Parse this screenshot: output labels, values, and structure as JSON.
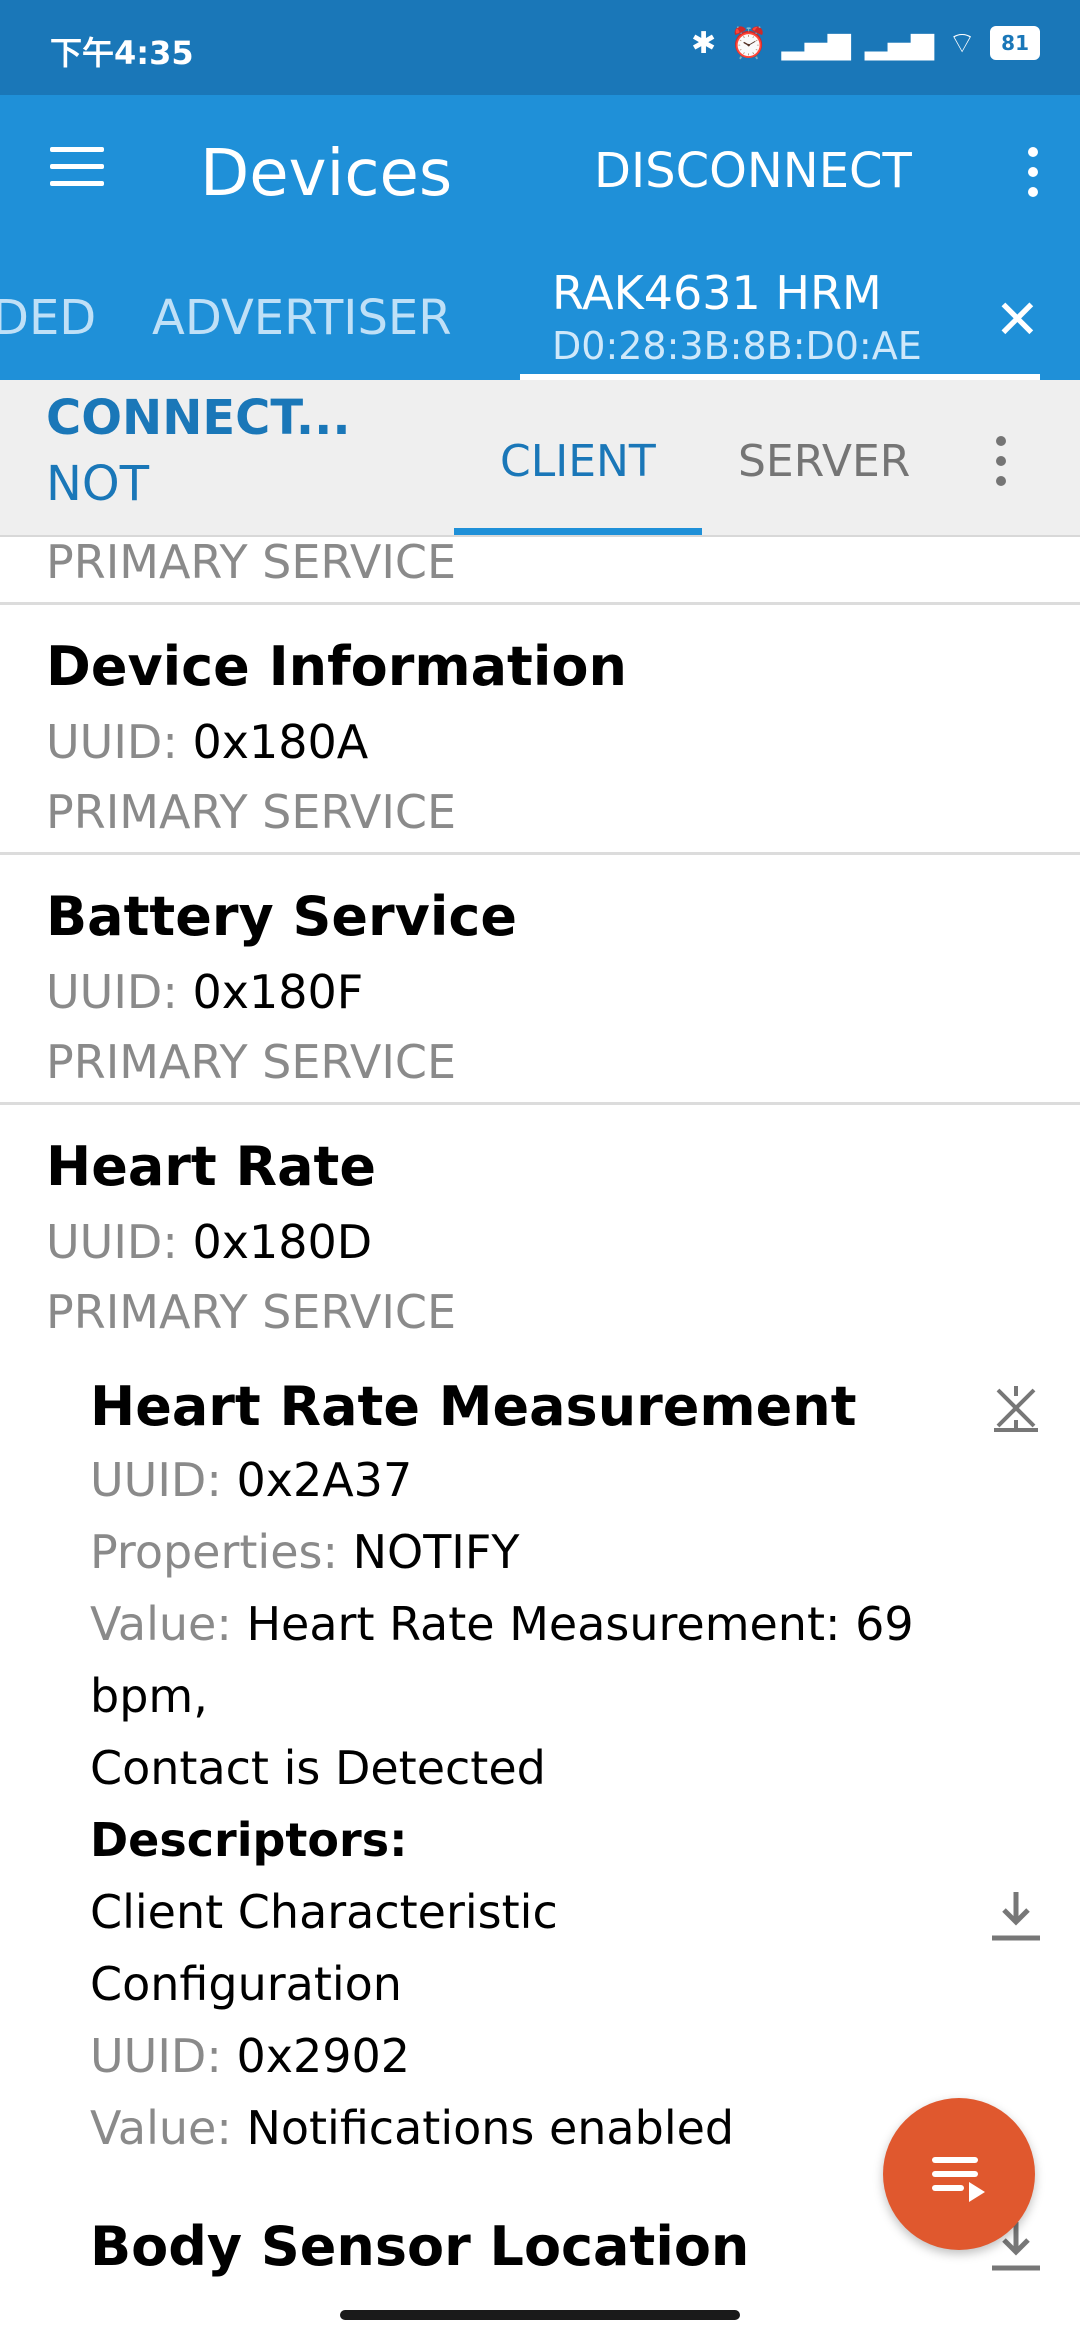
{
  "status_bar": {
    "time": "下午4:35",
    "battery": "81"
  },
  "app_bar": {
    "title": "Devices",
    "disconnect_label": "DISCONNECT"
  },
  "device_tabs": {
    "partial_tab": "DED",
    "advertiser_tab": "ADVERTISER",
    "device_name": "RAK4631 HRM",
    "device_address": "D0:28:3B:8B:D0:AE"
  },
  "sub_bar": {
    "connection_state_line1": "CONNECT...",
    "connection_state_line2": "NOT",
    "tab_client": "CLIENT",
    "tab_server": "SERVER"
  },
  "labels": {
    "uuid": "UUID: ",
    "primary_service": "PRIMARY SERVICE",
    "properties": "Properties: ",
    "value": "Value: ",
    "descriptors": "Descriptors:"
  },
  "services": [
    {
      "name": "Device Information",
      "uuid": "0x180A"
    },
    {
      "name": "Battery Service",
      "uuid": "0x180F"
    },
    {
      "name": "Heart Rate",
      "uuid": "0x180D"
    }
  ],
  "characteristic": {
    "name": "Heart Rate Measurement",
    "uuid": "0x2A37",
    "properties": "NOTIFY",
    "value_line1": "Heart Rate Measurement: 69",
    "value_line2": "bpm,",
    "value_line3": "Contact is Detected",
    "descriptor_name_line1": "Client Characteristic",
    "descriptor_name_line2": "Configuration",
    "descriptor_uuid": "0x2902",
    "descriptor_value": "Notifications enabled"
  },
  "next_characteristic": {
    "name": "Body Sensor Location"
  }
}
